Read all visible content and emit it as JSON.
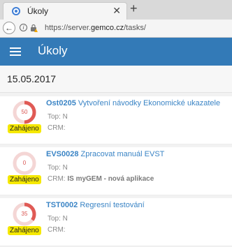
{
  "browser": {
    "tab_title": "Úkoly",
    "tab_close": "✕",
    "new_tab": "+",
    "back": "←",
    "info": "i",
    "url_prefix": "https://server.",
    "url_host": "gemco.cz",
    "url_path": "/tasks/"
  },
  "header": {
    "menu_icon": "hamburger-menu-icon",
    "title": "Úkoly",
    "color": "#337ab7"
  },
  "date": "15.05.2017",
  "tasks": [
    {
      "code": "Ost0205",
      "name": "Vytvoření návodky Ekonomické ukazatele",
      "progress": 50,
      "progress_label": "50",
      "status": "Zahájeno",
      "top_label": "Top: N",
      "crm_label": "CRM:",
      "crm_value": ""
    },
    {
      "code": "EVS0028",
      "name": "Zpracovat manuál EVST",
      "progress": 0,
      "progress_label": "0",
      "status": "Zahájeno",
      "top_label": "Top: N",
      "crm_label": "CRM:",
      "crm_value": "IS myGEM - nová aplikace"
    },
    {
      "code": "TST0002",
      "name": "Regresní testování",
      "progress": 35,
      "progress_label": "35",
      "status": "Zahájeno",
      "top_label": "Top: N",
      "crm_label": "CRM:",
      "crm_value": ""
    }
  ],
  "colors": {
    "progress": "#e05a55",
    "progress_track": "#f4d6d5",
    "badge": "#f5e800",
    "link": "#3a84c5"
  }
}
